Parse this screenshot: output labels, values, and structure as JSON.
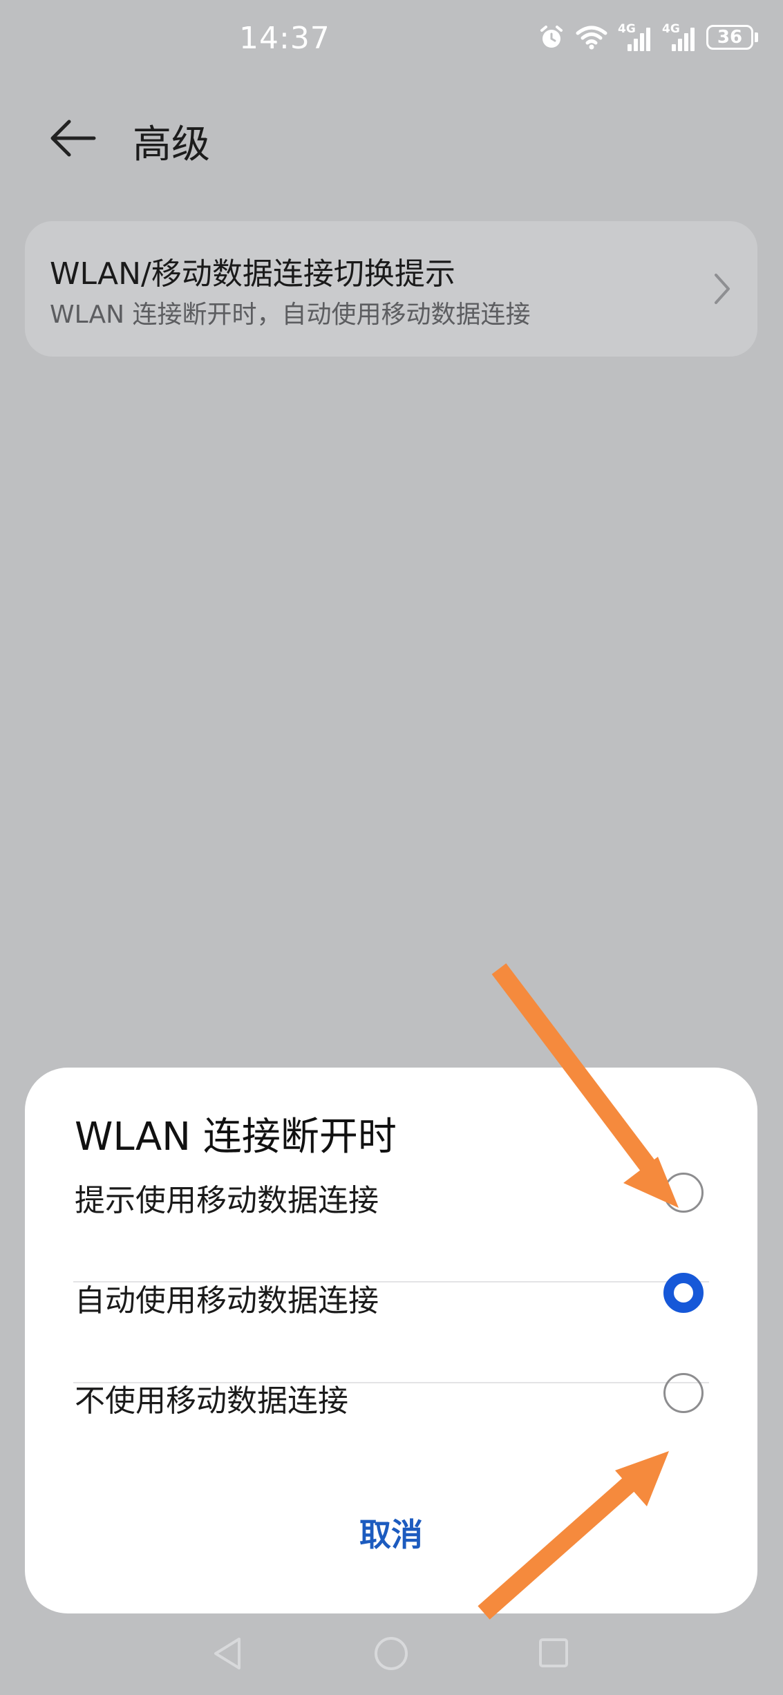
{
  "status_bar": {
    "time": "14:37",
    "network_left": "4G",
    "network_right": "4G",
    "battery": "36",
    "icons": [
      "alarm-icon",
      "wifi-icon",
      "signal-icon",
      "signal-icon",
      "battery-icon"
    ]
  },
  "header": {
    "title": "高级",
    "back_icon": "back-arrow-icon"
  },
  "setting": {
    "title": "WLAN/移动数据连接切换提示",
    "subtitle": "WLAN 连接断开时，自动使用移动数据连接",
    "chevron_icon": "chevron-right-icon"
  },
  "dialog": {
    "title": "WLAN 连接断开时",
    "options": [
      {
        "label": "提示使用移动数据连接",
        "selected": false
      },
      {
        "label": "自动使用移动数据连接",
        "selected": true
      },
      {
        "label": "不使用移动数据连接",
        "selected": false
      }
    ],
    "cancel_label": "取消"
  },
  "navbar": {
    "icons": [
      "nav-back-icon",
      "nav-home-icon",
      "nav-recents-icon"
    ]
  },
  "colors": {
    "accent": "#1658d8",
    "cancel_text": "#1c5bbf",
    "annotation_arrow": "#f58a3d",
    "background_dim": "#bebfc1"
  }
}
